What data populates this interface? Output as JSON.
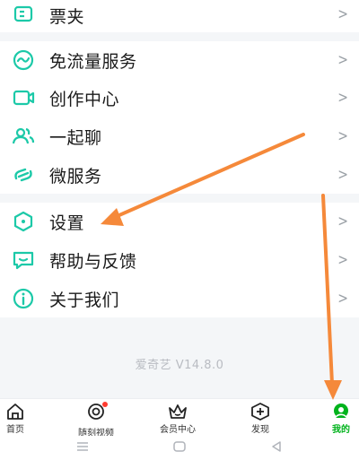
{
  "menu": {
    "ticket": {
      "label": "票夹",
      "icon": "ticket-icon"
    },
    "free_traffic": {
      "label": "免流量服务",
      "icon": "wave-circle-icon"
    },
    "creation": {
      "label": "创作中心",
      "icon": "video-camera-icon"
    },
    "chat": {
      "label": "一起聊",
      "icon": "people-icon"
    },
    "micro": {
      "label": "微服务",
      "icon": "link-icon"
    },
    "settings": {
      "label": "设置",
      "icon": "settings-hexagon-icon"
    },
    "help": {
      "label": "帮助与反馈",
      "icon": "message-icon"
    },
    "about": {
      "label": "关于我们",
      "icon": "info-icon"
    },
    "chevron": ">"
  },
  "version": "爱奇艺 V14.8.0",
  "tabbar": {
    "home": "首页",
    "random_video": "随刻视频",
    "vip": "会员中心",
    "discover": "发现",
    "mine": "我的"
  },
  "colors": {
    "accent": "#00b31c",
    "icon_teal": "#1cc9a8",
    "arrow": "#f5893a"
  }
}
